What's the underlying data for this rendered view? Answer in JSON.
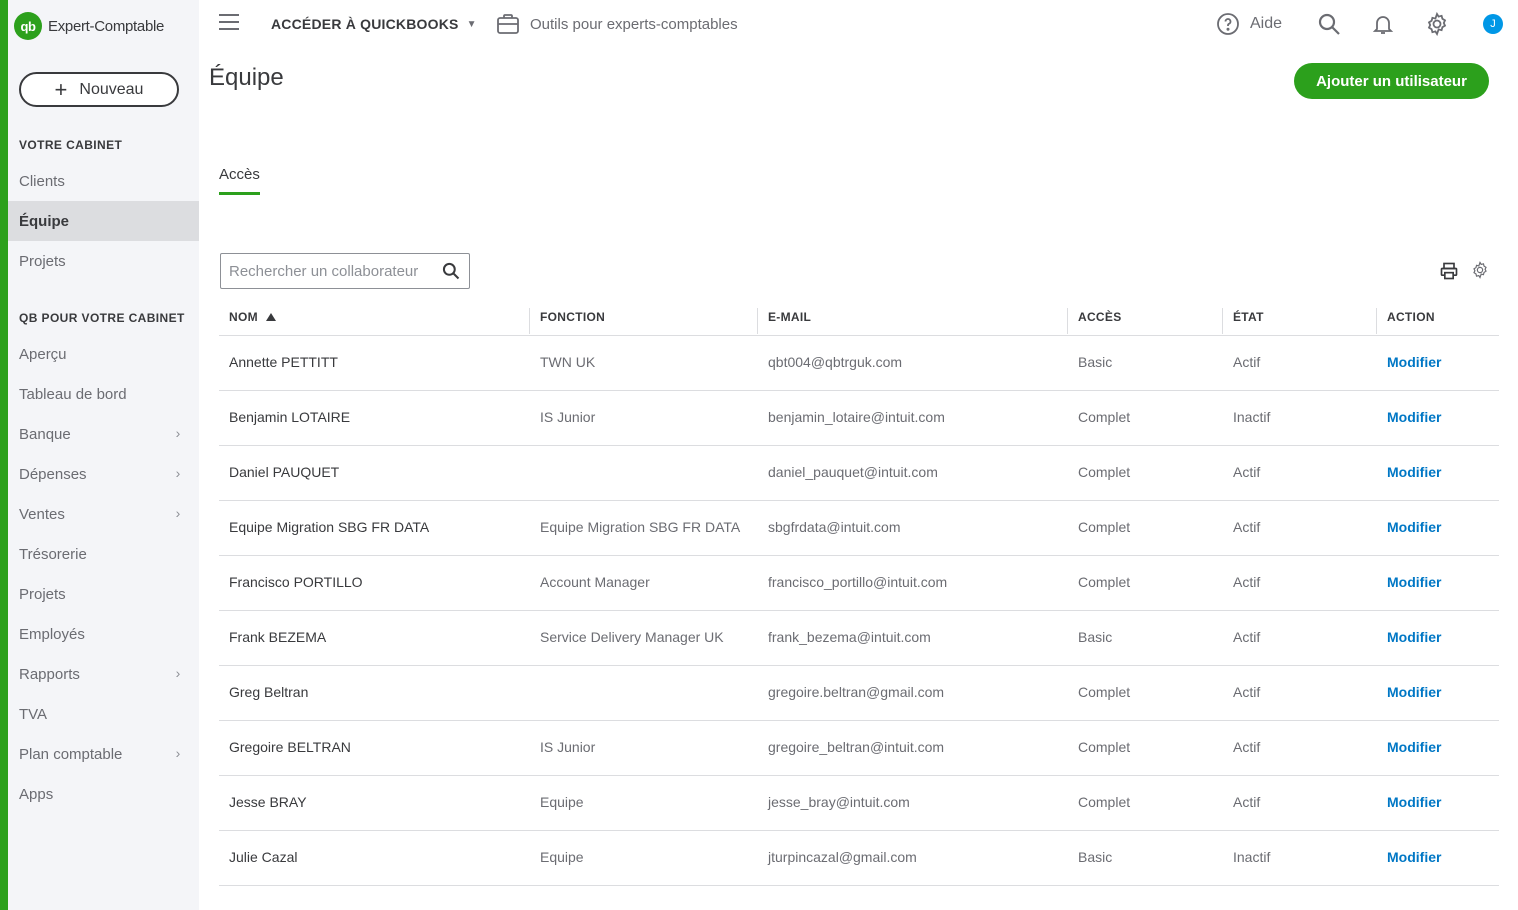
{
  "brand": {
    "logo_text": "qb",
    "name": "Expert-Comptable"
  },
  "sidebar": {
    "new_button": "Nouveau",
    "section_firm": "VOTRE CABINET",
    "firm_items": [
      {
        "label": "Clients"
      },
      {
        "label": "Équipe",
        "active": true
      },
      {
        "label": "Projets"
      }
    ],
    "section_qb": "QB POUR VOTRE CABINET",
    "qb_items": [
      {
        "label": "Aperçu",
        "chevron": false
      },
      {
        "label": "Tableau de bord",
        "chevron": false
      },
      {
        "label": "Banque",
        "chevron": true
      },
      {
        "label": "Dépenses",
        "chevron": true
      },
      {
        "label": "Ventes",
        "chevron": true
      },
      {
        "label": "Trésorerie",
        "chevron": false
      },
      {
        "label": "Projets",
        "chevron": false
      },
      {
        "label": "Employés",
        "chevron": false
      },
      {
        "label": "Rapports",
        "chevron": true
      },
      {
        "label": "TVA",
        "chevron": false
      },
      {
        "label": "Plan comptable",
        "chevron": true
      },
      {
        "label": "Apps",
        "chevron": false
      }
    ]
  },
  "topbar": {
    "access_qb": "ACCÉDER À QUICKBOOKS",
    "tools": "Outils pour experts-comptables",
    "help": "Aide",
    "avatar": "J",
    "icons": [
      "hamburger-icon",
      "briefcase-icon",
      "help-icon",
      "search-icon",
      "bell-icon",
      "gear-icon"
    ]
  },
  "page": {
    "title": "Équipe",
    "add_user": "Ajouter un utilisateur",
    "tab": "Accès",
    "search_placeholder": "Rechercher un collaborateur"
  },
  "table": {
    "headers": [
      "NOM",
      "FONCTION",
      "E-MAIL",
      "ACCÈS",
      "ÉTAT",
      "ACTION"
    ],
    "sort_column": "NOM",
    "rows": [
      {
        "name": "Annette PETTITT",
        "function": "TWN UK",
        "email": "qbt004@qbtrguk.com",
        "access": "Basic",
        "state": "Actif",
        "action": "Modifier"
      },
      {
        "name": "Benjamin LOTAIRE",
        "function": "IS Junior",
        "email": "benjamin_lotaire@intuit.com",
        "access": "Complet",
        "state": "Inactif",
        "action": "Modifier"
      },
      {
        "name": "Daniel PAUQUET",
        "function": "",
        "email": "daniel_pauquet@intuit.com",
        "access": "Complet",
        "state": "Actif",
        "action": "Modifier"
      },
      {
        "name": "Equipe Migration SBG FR DATA",
        "function": "Equipe Migration SBG FR DATA",
        "email": "sbgfrdata@intuit.com",
        "access": "Complet",
        "state": "Actif",
        "action": "Modifier"
      },
      {
        "name": "Francisco PORTILLO",
        "function": "Account Manager",
        "email": "francisco_portillo@intuit.com",
        "access": "Complet",
        "state": "Actif",
        "action": "Modifier"
      },
      {
        "name": "Frank BEZEMA",
        "function": "Service Delivery Manager UK",
        "email": "frank_bezema@intuit.com",
        "access": "Basic",
        "state": "Actif",
        "action": "Modifier"
      },
      {
        "name": "Greg Beltran",
        "function": "",
        "email": "gregoire.beltran@gmail.com",
        "access": "Complet",
        "state": "Actif",
        "action": "Modifier"
      },
      {
        "name": "Gregoire BELTRAN",
        "function": "IS Junior",
        "email": "gregoire_beltran@intuit.com",
        "access": "Complet",
        "state": "Actif",
        "action": "Modifier"
      },
      {
        "name": "Jesse BRAY",
        "function": "Equipe",
        "email": "jesse_bray@intuit.com",
        "access": "Complet",
        "state": "Actif",
        "action": "Modifier"
      },
      {
        "name": "Julie Cazal",
        "function": "Equipe",
        "email": "jturpincazal@gmail.com",
        "access": "Basic",
        "state": "Inactif",
        "action": "Modifier"
      }
    ]
  },
  "colors": {
    "brand_green": "#2ca01c",
    "link_blue": "#0077c5",
    "sidebar_bg": "#f4f5f8",
    "active_bg": "#dcdde0"
  }
}
